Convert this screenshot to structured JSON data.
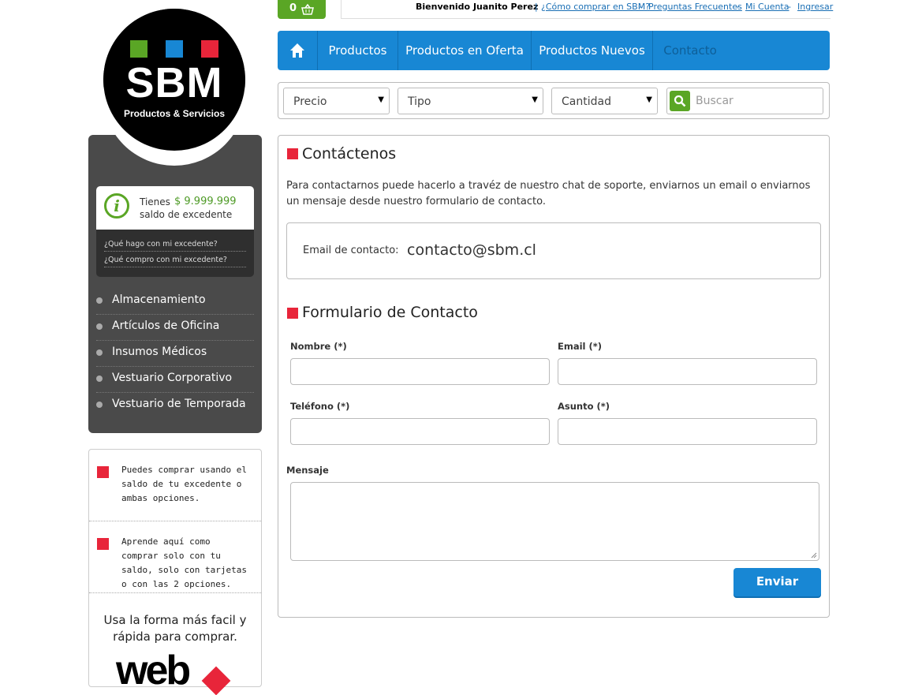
{
  "logo": {
    "text": "SBM",
    "subtitle": "Productos & Servicios",
    "colors": [
      "#5aa625",
      "#1887d4",
      "#e8253a"
    ]
  },
  "cart": {
    "count": "0",
    "icon": "basket-icon"
  },
  "topbar": {
    "welcome": "Bienvenido Juanito Perez",
    "links": [
      "¿Cómo comprar en SBM?",
      "Preguntas Frecuentes",
      "Mi Cuenta",
      "Ingresar"
    ],
    "separator": "-"
  },
  "nav": {
    "home_icon": "home-icon",
    "items": [
      "Productos",
      "Productos en Oferta",
      "Productos Nuevos",
      "Contacto"
    ]
  },
  "filters": {
    "selects": [
      "Precio",
      "Tipo",
      "Cantidad"
    ],
    "search_placeholder": "Buscar"
  },
  "balance": {
    "line1": "Tienes",
    "amount": "$ 9.999.999",
    "line2": "saldo de excedente",
    "links": [
      "¿Qué hago con mi excedente?",
      "¿Qué compro con mi excedente?"
    ]
  },
  "categories": [
    "Almacenamiento",
    "Artículos de Oficina",
    "Insumos Médicos",
    "Vestuario Corporativo",
    "Vestuario de Temporada"
  ],
  "promo": {
    "items": [
      "Puedes comprar usando el saldo de tu excedente o ambas opciones.",
      "Aprende aquí como comprar solo con tu saldo, solo con tarjetas o con las 2 opciones."
    ],
    "cta": "Usa la forma más facil y rápida para comprar.",
    "brand": "web"
  },
  "contact": {
    "title": "Contáctenos",
    "intro": "Para contactarnos puede hacerlo a travéz de nuestro chat de soporte, enviarnos un email o enviarnos un mensaje desde nuestro formulario de contacto.",
    "email_label": "Email de contacto:",
    "email_value": "contacto@sbm.cl"
  },
  "form": {
    "title": "Formulario de Contacto",
    "nombre_label": "Nombre (*)",
    "email_label": "Email (*)",
    "telefono_label": "Teléfono (*)",
    "asunto_label": "Asunto (*)",
    "mensaje_label": "Mensaje",
    "submit_label": "Enviar"
  }
}
